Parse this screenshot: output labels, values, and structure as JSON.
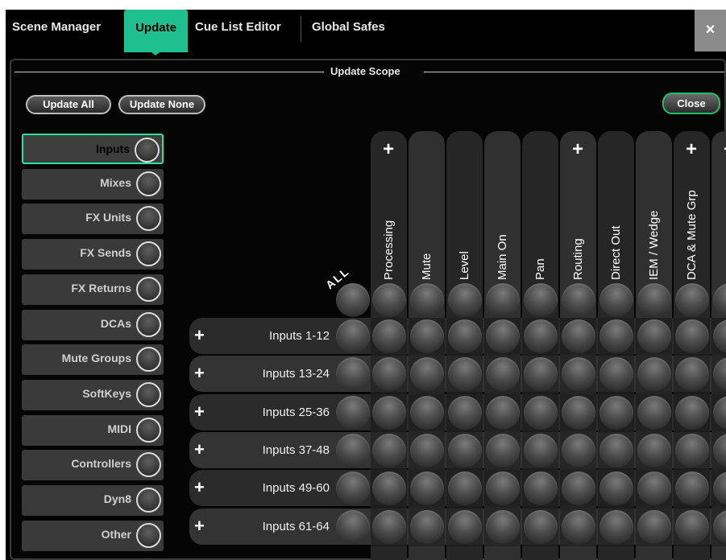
{
  "tabs": [
    {
      "label": "Scene Manager",
      "active": false
    },
    {
      "label": "Update",
      "active": true
    },
    {
      "label": "Cue List Editor",
      "active": false
    },
    {
      "label": "Global Safes",
      "active": false
    }
  ],
  "window_close_glyph": "×",
  "scope_title": "Update Scope",
  "buttons": {
    "update_all": "Update All",
    "update_none": "Update None",
    "close": "Close"
  },
  "sidebar": [
    {
      "label": "Inputs",
      "active": true
    },
    {
      "label": "Mixes",
      "active": false
    },
    {
      "label": "FX Units",
      "active": false
    },
    {
      "label": "FX Sends",
      "active": false
    },
    {
      "label": "FX Returns",
      "active": false
    },
    {
      "label": "DCAs",
      "active": false
    },
    {
      "label": "Mute Groups",
      "active": false
    },
    {
      "label": "SoftKeys",
      "active": false
    },
    {
      "label": "MIDI",
      "active": false
    },
    {
      "label": "Controllers",
      "active": false
    },
    {
      "label": "Dyn8",
      "active": false
    },
    {
      "label": "Other",
      "active": false
    }
  ],
  "matrix": {
    "all_label": "ALL",
    "plus_glyph": "+",
    "columns": [
      {
        "label": "Processing",
        "expandable": true
      },
      {
        "label": "Mute",
        "expandable": false
      },
      {
        "label": "Level",
        "expandable": false
      },
      {
        "label": "Main On",
        "expandable": false
      },
      {
        "label": "Pan",
        "expandable": false
      },
      {
        "label": "Routing",
        "expandable": true
      },
      {
        "label": "Direct Out",
        "expandable": false
      },
      {
        "label": "IEM / Wedge",
        "expandable": false
      },
      {
        "label": "DCA & Mute Grp",
        "expandable": true
      },
      {
        "label": "",
        "expandable": true
      }
    ],
    "rows": [
      {
        "label": "Inputs 1-12"
      },
      {
        "label": "Inputs 13-24"
      },
      {
        "label": "Inputs 25-36"
      },
      {
        "label": "Inputs 37-48"
      },
      {
        "label": "Inputs 49-60"
      },
      {
        "label": "Inputs 61-64"
      }
    ]
  },
  "colors": {
    "accent": "#1fbf8f",
    "close_border": "#1fbf6a",
    "background": "#000000"
  }
}
